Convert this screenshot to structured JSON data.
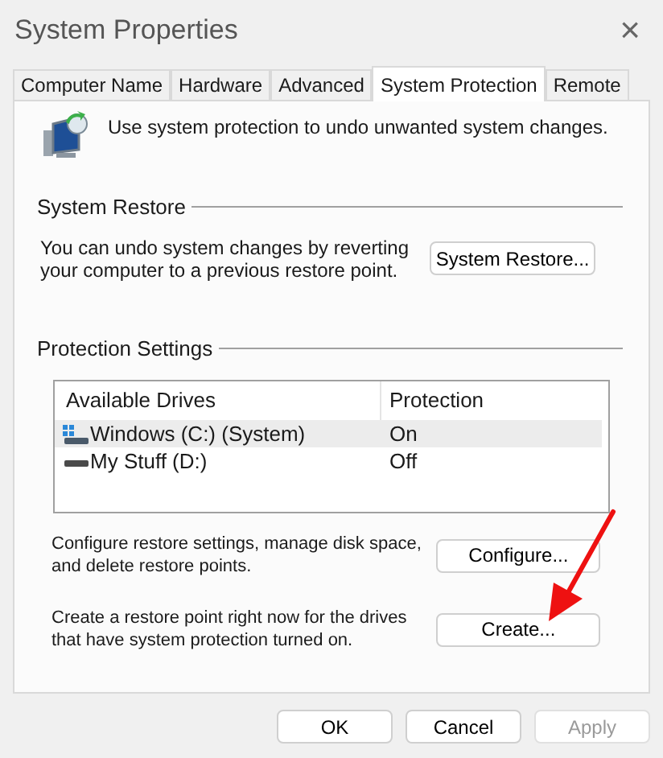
{
  "window": {
    "title": "System Properties",
    "close": "×"
  },
  "tabs": [
    {
      "label": "Computer Name",
      "selected": false
    },
    {
      "label": "Hardware",
      "selected": false
    },
    {
      "label": "Advanced",
      "selected": false
    },
    {
      "label": "System Protection",
      "selected": true
    },
    {
      "label": "Remote",
      "selected": false
    }
  ],
  "intro": "Use system protection to undo unwanted system changes.",
  "system_restore": {
    "heading": "System Restore",
    "text": "You can undo system changes by reverting your computer to a previous restore point.",
    "button": "System Restore..."
  },
  "protection_settings": {
    "heading": "Protection Settings",
    "columns": [
      "Available Drives",
      "Protection"
    ],
    "drives": [
      {
        "name": "Windows (C:) (System)",
        "protection": "On",
        "kind": "system",
        "selected": true
      },
      {
        "name": "My Stuff (D:)",
        "protection": "Off",
        "kind": "data",
        "selected": false
      }
    ],
    "actions": [
      {
        "text": "Configure restore settings, manage disk space, and delete restore points.",
        "button": "Configure..."
      },
      {
        "text": "Create a restore point right now for the drives that have system protection turned on.",
        "button": "Create..."
      }
    ]
  },
  "buttons": [
    {
      "label": "OK",
      "disabled": false
    },
    {
      "label": "Cancel",
      "disabled": false
    },
    {
      "label": "Apply",
      "disabled": true
    }
  ]
}
